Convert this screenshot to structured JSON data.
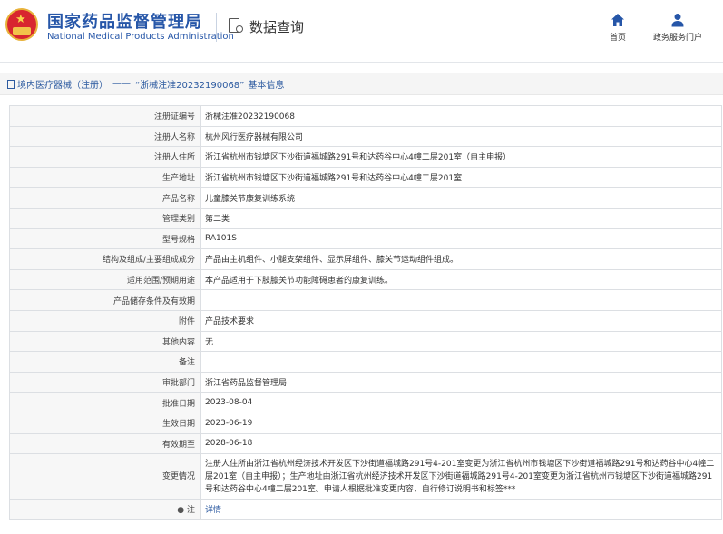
{
  "header": {
    "org_name_cn": "国家药品监督管理局",
    "org_name_en": "National Medical Products Administration",
    "section_title": "数据查询",
    "nav": [
      {
        "label": "首页",
        "icon": "home-icon"
      },
      {
        "label": "政务服务门户",
        "icon": "user-icon"
      }
    ]
  },
  "breadcrumb": {
    "category": "境内医疗器械（注册）",
    "separator": "——",
    "reg_quoted": "“浙械注准20232190068”",
    "suffix": "基本信息"
  },
  "table": [
    {
      "label": "注册证编号",
      "value": "浙械注准20232190068"
    },
    {
      "label": "注册人名称",
      "value": "杭州风行医疗器械有限公司"
    },
    {
      "label": "注册人住所",
      "value": "浙江省杭州市钱塘区下沙街道福城路291号和达药谷中心4幢二层201室（自主申报）"
    },
    {
      "label": "生产地址",
      "value": "浙江省杭州市钱塘区下沙街道福城路291号和达药谷中心4幢二层201室"
    },
    {
      "label": "产品名称",
      "value": "儿童膝关节康复训练系统"
    },
    {
      "label": "管理类别",
      "value": "第二类"
    },
    {
      "label": "型号规格",
      "value": "RA101S"
    },
    {
      "label": "结构及组成/主要组成成分",
      "value": "产品由主机组件、小腿支架组件、显示屏组件、膝关节运动组件组成。"
    },
    {
      "label": "适用范围/预期用途",
      "value": "本产品适用于下肢膝关节功能障碍患者的康复训练。"
    },
    {
      "label": "产品储存条件及有效期",
      "value": ""
    },
    {
      "label": "附件",
      "value": "产品技术要求"
    },
    {
      "label": "其他内容",
      "value": "无"
    },
    {
      "label": "备注",
      "value": ""
    },
    {
      "label": "审批部门",
      "value": "浙江省药品监督管理局"
    },
    {
      "label": "批准日期",
      "value": "2023-08-04"
    },
    {
      "label": "生效日期",
      "value": "2023-06-19"
    },
    {
      "label": "有效期至",
      "value": "2028-06-18"
    },
    {
      "label": "变更情况",
      "value": "注册人住所由浙江省杭州经济技术开发区下沙街道福城路291号4-201室变更为浙江省杭州市钱塘区下沙街道福城路291号和达药谷中心4幢二层201室（自主申报）；生产地址由浙江省杭州经济技术开发区下沙街道福城路291号4-201室变更为浙江省杭州市钱塘区下沙街道福城路291号和达药谷中心4幢二层201室。申请人根据批准变更内容，自行修订说明书和标签***"
    },
    {
      "label": "注",
      "value": "详情"
    }
  ]
}
